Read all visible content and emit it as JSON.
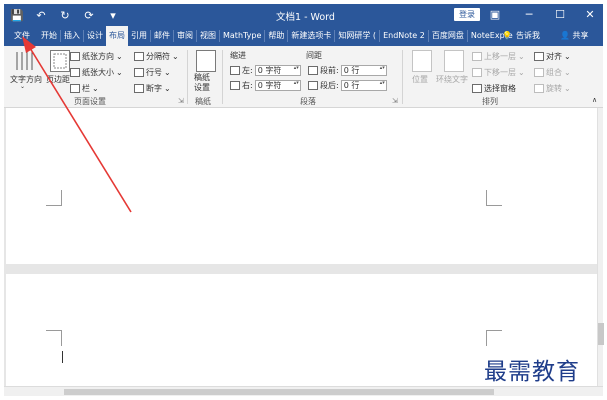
{
  "window": {
    "title": "文档1 - Word",
    "login_label": "登录",
    "quick_access": [
      "save-icon",
      "undo-icon",
      "redo-icon",
      "refresh-icon",
      "customize-icon"
    ]
  },
  "tabs": [
    "文件",
    "开始",
    "插入",
    "设计",
    "布局",
    "引用",
    "邮件",
    "审阅",
    "视图",
    "MathType",
    "帮助",
    "新建选项卡",
    "知网研学 (",
    "EndNote 2",
    "百度网盘",
    "NoteExpre"
  ],
  "active_tab": "布局",
  "tell_me": "告诉我",
  "share": "共享",
  "ribbon": {
    "page_setup": {
      "label": "页面设置",
      "text_direction": "文字方向",
      "margins": "页边距",
      "orientation": "纸张方向",
      "size": "纸张大小",
      "columns": "栏",
      "breaks": "分隔符",
      "line_numbers": "行号",
      "hyphenation": "断字"
    },
    "manuscript": {
      "label": "稿纸",
      "button": "稿纸\n设置"
    },
    "paragraph": {
      "label": "段落",
      "indent_title": "缩进",
      "spacing_title": "间距",
      "left_label": "左:",
      "left_value": "0 字符",
      "right_label": "右:",
      "right_value": "0 字符",
      "before_label": "段前:",
      "before_value": "0 行",
      "after_label": "段后:",
      "after_value": "0 行"
    },
    "arrange": {
      "label": "排列",
      "position": "位置",
      "wrap_text": "环绕文字",
      "bring_forward": "上移一层",
      "send_backward": "下移一层",
      "selection_pane": "选择窗格",
      "align": "对齐",
      "group": "组合",
      "rotate": "旋转"
    }
  },
  "watermark": "最需教育",
  "colors": {
    "accent": "#2b579a",
    "arrow": "#e53935"
  }
}
